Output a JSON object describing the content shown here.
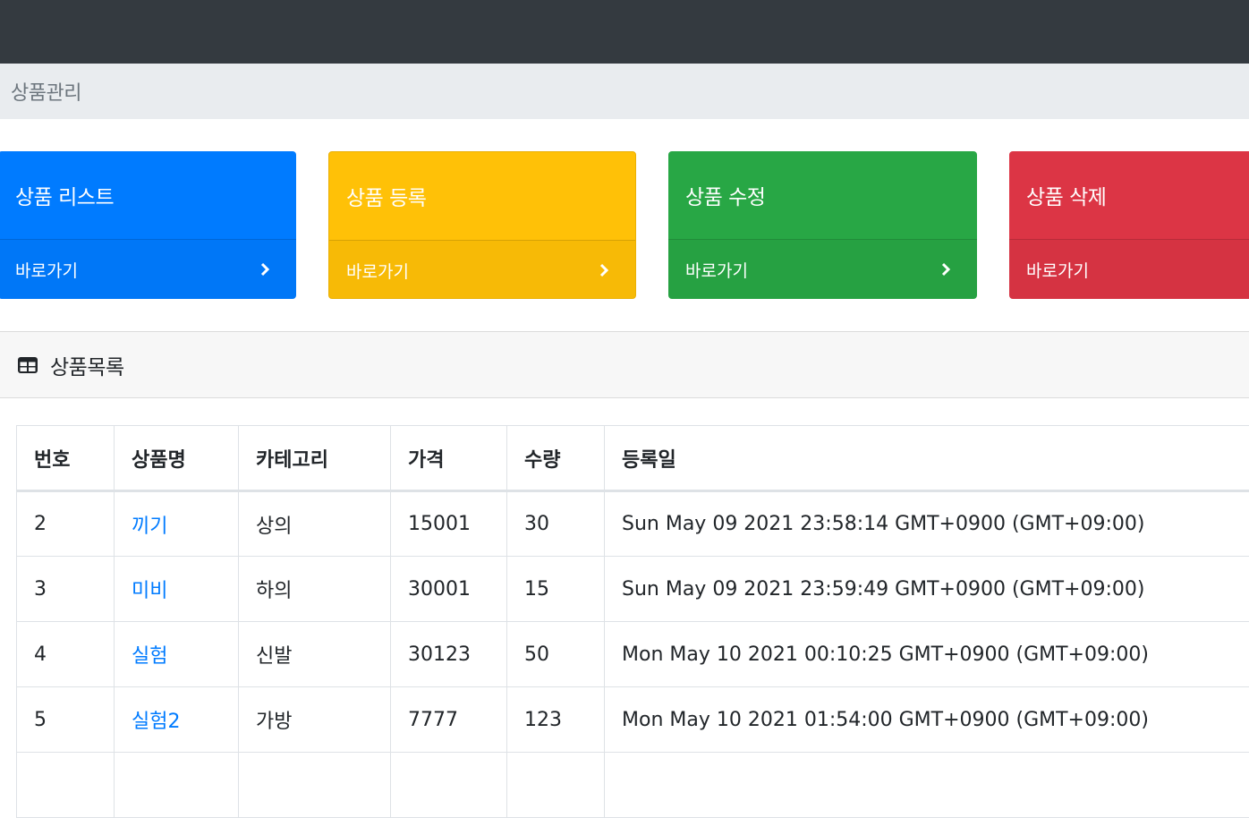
{
  "breadcrumb": {
    "title": "상품관리"
  },
  "cards": [
    {
      "title": "상품 리스트",
      "link": "바로가기",
      "color": "#007bff"
    },
    {
      "title": "상품 등록",
      "link": "바로가기",
      "color": "#ffc107"
    },
    {
      "title": "상품 수정",
      "link": "바로가기",
      "color": "#28a745"
    },
    {
      "title": "상품 삭제",
      "link": "바로가기",
      "color": "#dc3545"
    }
  ],
  "section": {
    "title": "상품목록",
    "icon": "table-icon"
  },
  "table": {
    "columns": [
      "번호",
      "상품명",
      "카테고리",
      "가격",
      "수량",
      "등록일"
    ],
    "rows": [
      [
        "2",
        "끼기",
        "상의",
        "15001",
        "30",
        "Sun May 09 2021 23:58:14 GMT+0900 (GMT+09:00)"
      ],
      [
        "3",
        "미비",
        "하의",
        "30001",
        "15",
        "Sun May 09 2021 23:59:49 GMT+0900 (GMT+09:00)"
      ],
      [
        "4",
        "실험",
        "신발",
        "30123",
        "50",
        "Mon May 10 2021 00:10:25 GMT+0900 (GMT+09:00)"
      ],
      [
        "5",
        "실험2",
        "가방",
        "7777",
        "123",
        "Mon May 10 2021 01:54:00 GMT+0900 (GMT+09:00)"
      ]
    ]
  }
}
